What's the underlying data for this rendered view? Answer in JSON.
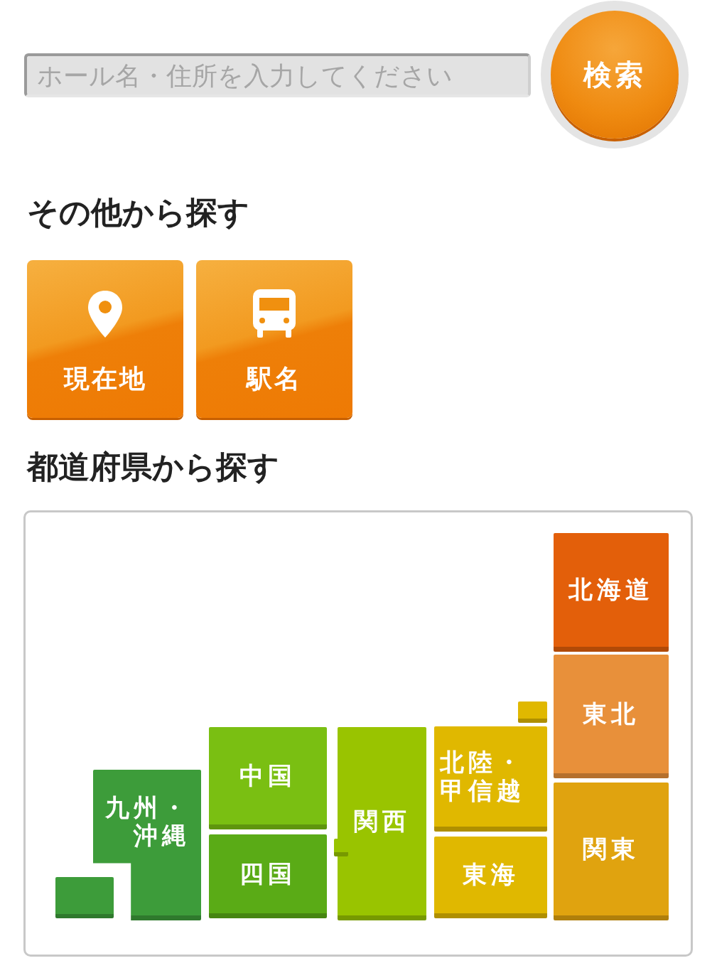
{
  "search": {
    "placeholder": "ホール名・住所を入力してください",
    "button": "検索"
  },
  "other_search": {
    "heading": "その他から探す",
    "buttons": [
      {
        "label": "現在地",
        "kind": "location"
      },
      {
        "label": "駅名",
        "kind": "station"
      }
    ]
  },
  "prefecture_search": {
    "heading": "都道府県から探す",
    "regions": [
      {
        "label": "北海道",
        "color": "#e35f0a"
      },
      {
        "label": "東北",
        "color": "#e8903a"
      },
      {
        "label": "関東",
        "color": "#e0a30f"
      },
      {
        "label": "北陸・甲信越",
        "color": "#e0b800"
      },
      {
        "label": "東海",
        "color": "#e0b800"
      },
      {
        "label": "関西",
        "color": "#99c400"
      },
      {
        "label": "中国",
        "color": "#7abf12"
      },
      {
        "label": "四国",
        "color": "#5aab16"
      },
      {
        "label": "九州・沖縄",
        "color": "#3d9c3a"
      }
    ]
  }
}
